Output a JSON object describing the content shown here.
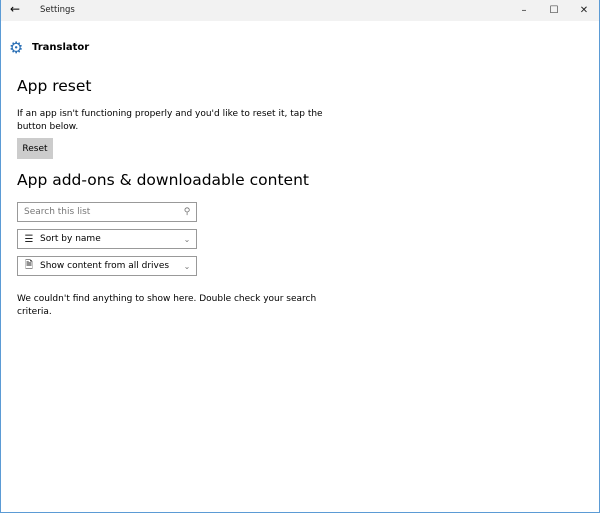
{
  "window": {
    "title": "Settings",
    "minimize_icon": "minimize-icon",
    "maximize_icon": "maximize-icon",
    "close_icon": "close-icon"
  },
  "header": {
    "app_name": "Translator",
    "icon": "gear-icon"
  },
  "reset_section": {
    "heading": "App reset",
    "description": "If an app isn't functioning properly and you'd like to reset it, tap the button below.",
    "button_label": "Reset"
  },
  "addons": {
    "heading": "App add-ons & downloadable content",
    "search_placeholder": "Search this list",
    "sort_value": "Sort by name",
    "filter_value": "Show content from all drives",
    "empty_message": "We couldn't find anything to show here. Double check your search criteria."
  },
  "colors": {
    "accent": "#2a6fb5",
    "button_bg": "#cccccc"
  }
}
